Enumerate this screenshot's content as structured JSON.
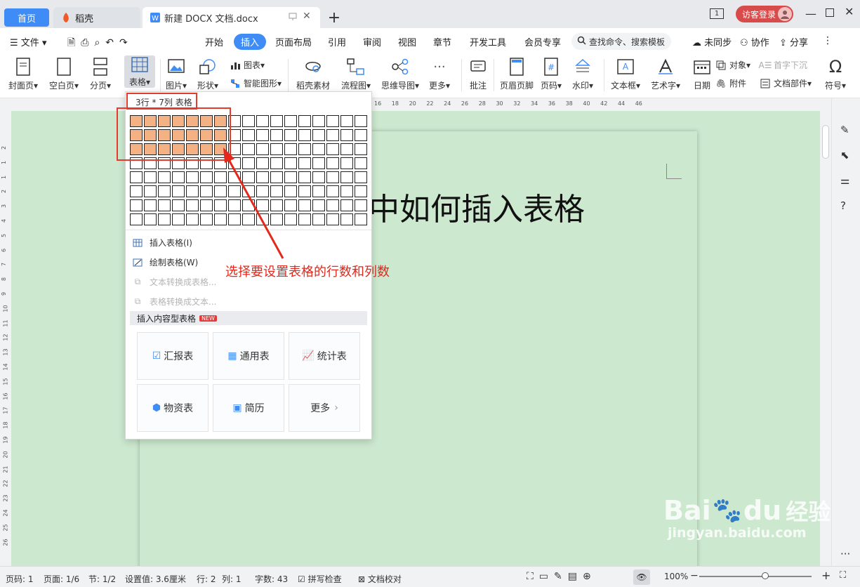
{
  "tabs": {
    "home": "首页",
    "daoke": "稻壳",
    "document": "新建 DOCX 文档.docx",
    "add": "+"
  },
  "titlebar": {
    "page_indicator": "1",
    "visitor_login": "访客登录"
  },
  "menu": {
    "file": "文件",
    "items": [
      "开始",
      "插入",
      "页面布局",
      "引用",
      "审阅",
      "视图",
      "章节",
      "开发工具",
      "会员专享"
    ],
    "active": "插入",
    "search_placeholder": "查找命令、搜索模板",
    "unsync": "未同步",
    "collab": "协作",
    "share": "分享"
  },
  "ribbon": {
    "cover": "封面页",
    "blank": "空白页",
    "pagebreak": "分页",
    "table": "表格",
    "picture": "图片",
    "shape": "形状",
    "chart": "图表",
    "smartart": "智能图形",
    "daoke_material": "稻壳素材",
    "flowchart": "流程图",
    "mindmap": "思维导图",
    "more": "更多",
    "comment": "批注",
    "header_footer": "页眉页脚",
    "page_number": "页码",
    "watermark": "水印",
    "textbox": "文本框",
    "wordart": "艺术字",
    "date": "日期",
    "object": "对象",
    "attachment": "附件",
    "dropcap": "首字下沉",
    "docparts": "文档部件",
    "symbol": "符号"
  },
  "ruler": {
    "top_ticks": [
      "16",
      "18",
      "20",
      "22",
      "24",
      "26",
      "28",
      "30",
      "32",
      "34",
      "36",
      "38",
      "40",
      "42",
      "44",
      "46"
    ],
    "left_ticks": [
      "2",
      "1",
      "1",
      "2",
      "3",
      "4",
      "5",
      "6",
      "7",
      "8",
      "9",
      "10",
      "11",
      "12",
      "13",
      "14",
      "15",
      "16",
      "17",
      "18",
      "19",
      "20",
      "21",
      "22",
      "23",
      "24",
      "25",
      "26"
    ]
  },
  "document": {
    "title_visible": "中如何插入表格"
  },
  "table_dropdown": {
    "header": "3行 * 7列 表格",
    "rows": 8,
    "cols": 17,
    "selected_rows": 3,
    "selected_cols": 7,
    "items": [
      {
        "label": "插入表格(I)",
        "enabled": true
      },
      {
        "label": "绘制表格(W)",
        "enabled": true
      },
      {
        "label": "文本转换成表格...",
        "enabled": false
      },
      {
        "label": "表格转换成文本...",
        "enabled": false
      }
    ],
    "content_header": "插入内容型表格",
    "new_badge": "NEW",
    "templates": [
      "汇报表",
      "通用表",
      "统计表",
      "物资表",
      "简历",
      "更多"
    ]
  },
  "annotation": {
    "callout": "选择要设置表格的行数和列数",
    "arrow_color": "#e3281c"
  },
  "statusbar": {
    "page": "页码: 1",
    "pages": "页面: 1/6",
    "section": "节: 1/2",
    "setting": "设置值: 3.6厘米",
    "row": "行: 2",
    "col": "列: 1",
    "words": "字数: 43",
    "spellcheck": "拼写检查",
    "proofread": "文档校对",
    "zoom": "100%",
    "zoom_level": 1.0
  },
  "watermark": {
    "brand": "Bai",
    "brand2": "du",
    "suffix": "经验",
    "url": "jingyan.baidu.com"
  },
  "colors": {
    "accent": "#3f8cf6",
    "canvas": "#cce8cf",
    "selected_cell": "#f4b183",
    "highlight_box": "#e53b2c",
    "visitor": "#d84b4b"
  }
}
